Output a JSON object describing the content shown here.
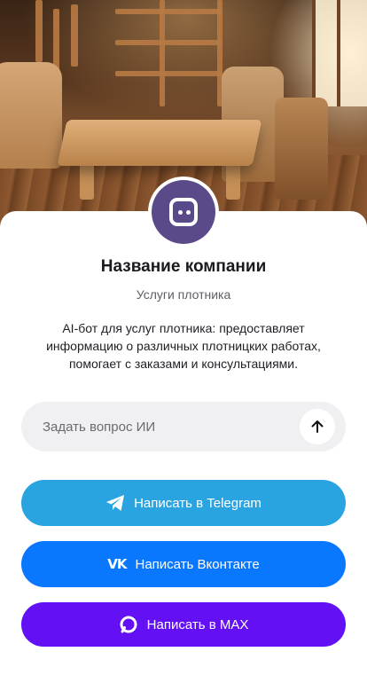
{
  "header": {
    "cover_image": "carpentry-workshop-photo",
    "avatar_icon": "chat-bot-icon",
    "avatar_color": "#5a4a8a"
  },
  "profile": {
    "company_name": "Название компании",
    "subtitle": "Услуги плотника",
    "description": "AI-бот для услуг плотника: предоставляет информацию о различных плотницких работах, помогает с заказами и консультациями."
  },
  "ask": {
    "placeholder": "Задать вопрос ИИ",
    "value": "",
    "send_icon": "arrow-up-icon"
  },
  "actions": [
    {
      "label": "Написать в Telegram",
      "icon": "telegram-icon",
      "color": "#2aa3e1"
    },
    {
      "label": "Написать Вконтакте",
      "icon": "vk-icon",
      "color": "#0a77ff"
    },
    {
      "label": "Написать в MAX",
      "icon": "max-icon",
      "color": "#6310f5"
    }
  ]
}
